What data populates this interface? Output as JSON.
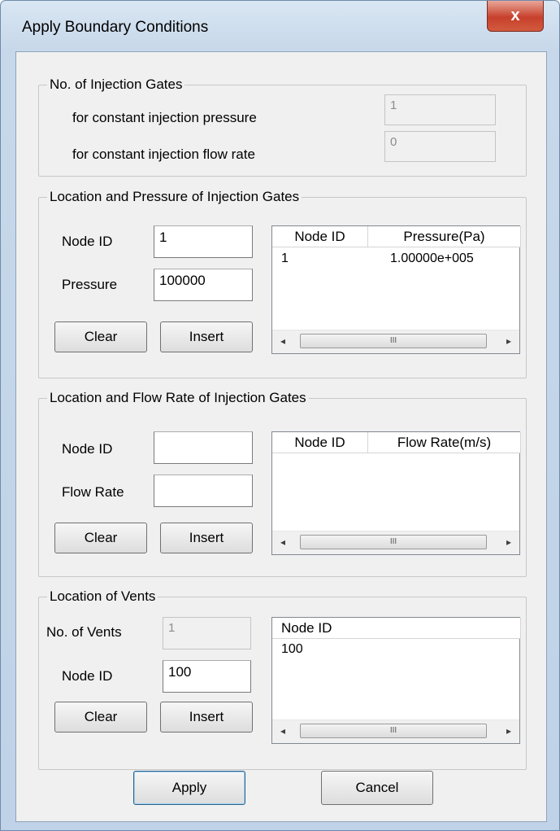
{
  "window": {
    "title": "Apply Boundary Conditions",
    "close_label": "x"
  },
  "gates": {
    "legend": "No. of Injection Gates",
    "pressure_label": "for constant injection pressure",
    "pressure_value": "1",
    "flow_label": "for constant injection flow rate",
    "flow_value": "0"
  },
  "pressure": {
    "legend": "Location and Pressure of Injection Gates",
    "node_label": "Node ID",
    "node_value": "1",
    "value_label": "Pressure",
    "value_value": "100000",
    "clear": "Clear",
    "insert": "Insert",
    "columns": [
      "Node ID",
      "Pressure(Pa)"
    ],
    "rows": [
      [
        "1",
        "1.00000e+005"
      ]
    ]
  },
  "flow": {
    "legend": "Location and Flow Rate of Injection Gates",
    "node_label": "Node ID",
    "node_value": "",
    "value_label": "Flow Rate",
    "value_value": "",
    "clear": "Clear",
    "insert": "Insert",
    "columns": [
      "Node ID",
      "Flow Rate(m/s)"
    ]
  },
  "vents": {
    "legend": "Location of Vents",
    "count_label": "No. of Vents",
    "count_value": "1",
    "node_label": "Node ID",
    "node_value": "100",
    "clear": "Clear",
    "insert": "Insert",
    "columns": [
      "Node ID"
    ],
    "rows": [
      [
        "100"
      ]
    ]
  },
  "footer": {
    "apply": "Apply",
    "cancel": "Cancel"
  },
  "scroll": {
    "left": "◂",
    "right": "▸",
    "grip": "III"
  }
}
